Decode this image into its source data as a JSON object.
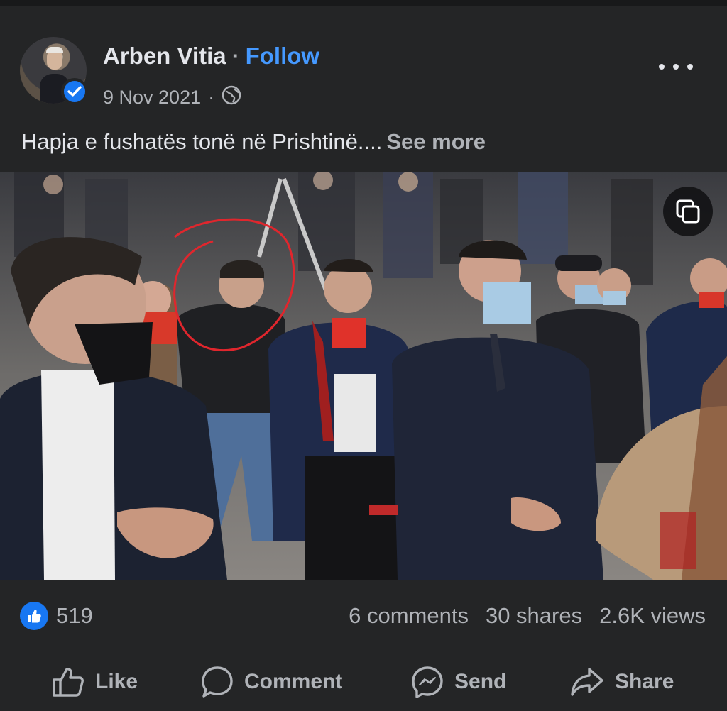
{
  "post": {
    "author": "Arben Vitia",
    "separator": "·",
    "follow_label": "Follow",
    "date": "9 Nov 2021",
    "meta_separator": "·",
    "privacy_icon": "globe-icon",
    "more_icon": "more-options-icon",
    "caption": "Hapja e fushatës tonë në Prishtinë....",
    "see_more_label": "See more"
  },
  "photo": {
    "multi_photo_icon": "multiple-photos-icon",
    "annotation": "red-circle-highlight"
  },
  "stats": {
    "likes": "519",
    "comments": "6 comments",
    "shares": "30 shares",
    "views": "2.6K views"
  },
  "actions": {
    "like": "Like",
    "comment": "Comment",
    "send": "Send",
    "share": "Share"
  },
  "colors": {
    "background": "#242526",
    "accent": "#4599ff",
    "like_blue": "#1877f2",
    "annotation_red": "#e0262d"
  }
}
